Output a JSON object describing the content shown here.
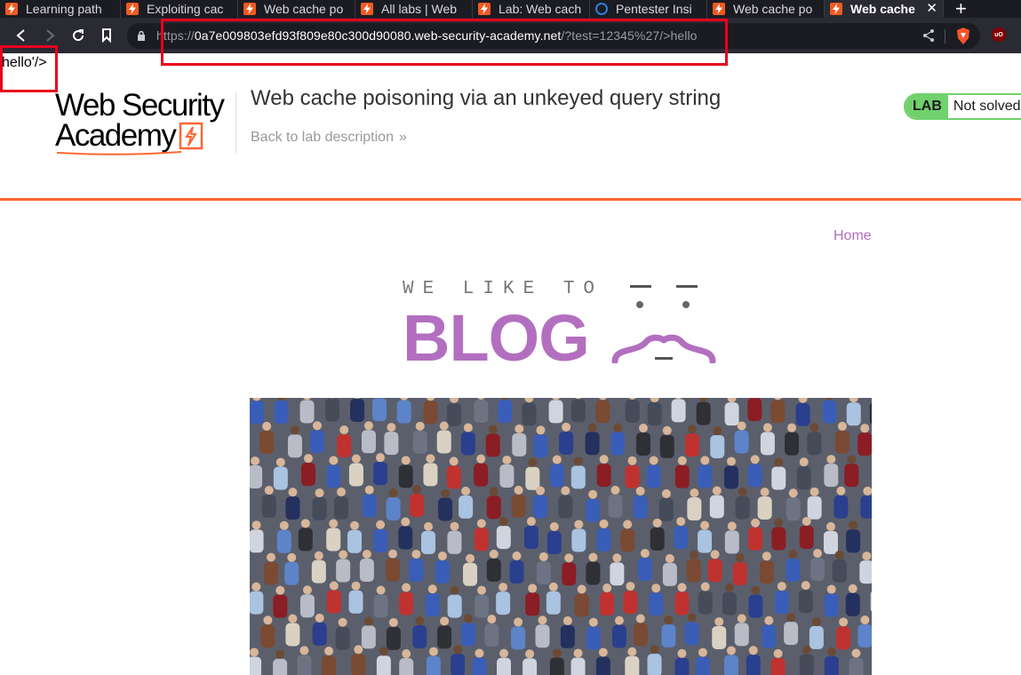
{
  "browser": {
    "tabs": [
      {
        "label": "Learning path",
        "icon": "portswigger-icon"
      },
      {
        "label": "Exploiting cac",
        "icon": "portswigger-icon"
      },
      {
        "label": "Web cache po",
        "icon": "portswigger-icon"
      },
      {
        "label": "All labs | Web",
        "icon": "portswigger-icon"
      },
      {
        "label": "Lab: Web cach",
        "icon": "portswigger-icon"
      },
      {
        "label": "Pentester Insi",
        "icon": "pentester-icon"
      },
      {
        "label": "Web cache po",
        "icon": "portswigger-icon"
      },
      {
        "label": "Web cache",
        "icon": "portswigger-icon",
        "active": true
      }
    ],
    "close_tab": "✕",
    "new_tab": "+",
    "url_scheme": "https://",
    "url_host": "0a7e009803efd93f809e80c300d90080.web-security-academy.net",
    "url_path": "/?test=12345%27/>hello"
  },
  "page": {
    "injected_text": "hello'/>",
    "logo": {
      "line1": "Web Security",
      "line2": "Academy"
    },
    "lab_title": "Web cache poisoning via an unkeyed query string",
    "back_link": "Back to lab description",
    "back_chevrons": "»",
    "lab_badge": {
      "tag": "LAB",
      "status": "Not solved"
    },
    "nav_home": "Home",
    "blog_tagline": "WE LIKE TO",
    "blog_word": "BLOG"
  },
  "colors": {
    "accent_orange": "#ff6633",
    "blog_purple": "#b36fbf",
    "lab_green": "#70d16d",
    "annotation_red": "#e8001c"
  }
}
